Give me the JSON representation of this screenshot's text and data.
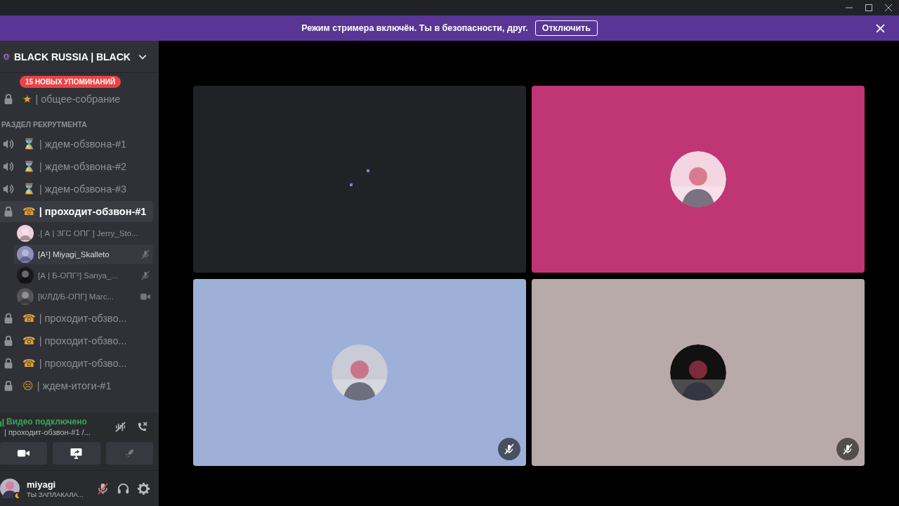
{
  "banner": {
    "text": "Режим стримера включён. Ты в безопасности, друг.",
    "button": "Отключить"
  },
  "server": {
    "name": "BLACK RUSSIA | BLACK"
  },
  "mentions_badge": "15 НОВЫХ УПОМИНАНИЙ",
  "channels_top": [
    {
      "kind": "locked",
      "emoji": "★",
      "name": "| общее-собрание",
      "selected": false
    }
  ],
  "category": "РАЗДЕЛ РЕКРУТМЕНТА",
  "channels": [
    {
      "kind": "voice",
      "emoji": "⌛",
      "name": "| ждем-обзвона-#1",
      "selected": false
    },
    {
      "kind": "voice",
      "emoji": "⌛",
      "name": "| ждем-обзвона-#2",
      "selected": false
    },
    {
      "kind": "voice",
      "emoji": "⌛",
      "name": "| ждем-обзвона-#3",
      "selected": false
    },
    {
      "kind": "locked",
      "emoji": "☎",
      "name": "| проходит-обзвон-#1",
      "selected": true,
      "members": [
        {
          "kind": "plain",
          "name": ".[ А | ЗГС ОПГ ] Jerry_Sto...",
          "color": "#f0d0dc",
          "selected": false
        },
        {
          "kind": "muted",
          "name": "[А¹] Miyagi_Skalleto",
          "color": "#8e8fc0",
          "selected": true
        },
        {
          "kind": "muted",
          "name": "[А | Б-ОПГ²] Sanya_...",
          "color": "#1a1a1a",
          "selected": false
        },
        {
          "kind": "video",
          "name": "[К/ЛД/Б-ОПГ] Marc...",
          "color": "#555555",
          "selected": false
        }
      ]
    },
    {
      "kind": "locked",
      "emoji": "☎",
      "name": "| проходит-обзво...",
      "selected": false
    },
    {
      "kind": "locked",
      "emoji": "☎",
      "name": "| проходит-обзво...",
      "selected": false
    },
    {
      "kind": "locked",
      "emoji": "☎",
      "name": "| проходит-обзво...",
      "selected": false
    },
    {
      "kind": "locked",
      "emoji": "☹",
      "name": "| ждем-итоги-#1",
      "selected": false
    }
  ],
  "voice_panel": {
    "status": "Видео подключено",
    "channel": "| проходит-обзвон-#1 /..."
  },
  "user": {
    "name": "miyagi",
    "status": "ТЫ ЗАПЛАКАЛА...",
    "mic_muted": true
  },
  "tiles": [
    {
      "kind": "loading",
      "color": "#202225",
      "muted": false
    },
    {
      "kind": "avatar",
      "color": "#c03574",
      "muted": false
    },
    {
      "kind": "avatar",
      "color": "#9eb0d8",
      "muted": true
    },
    {
      "kind": "avatar",
      "color": "#b8aaa9",
      "muted": true
    }
  ]
}
